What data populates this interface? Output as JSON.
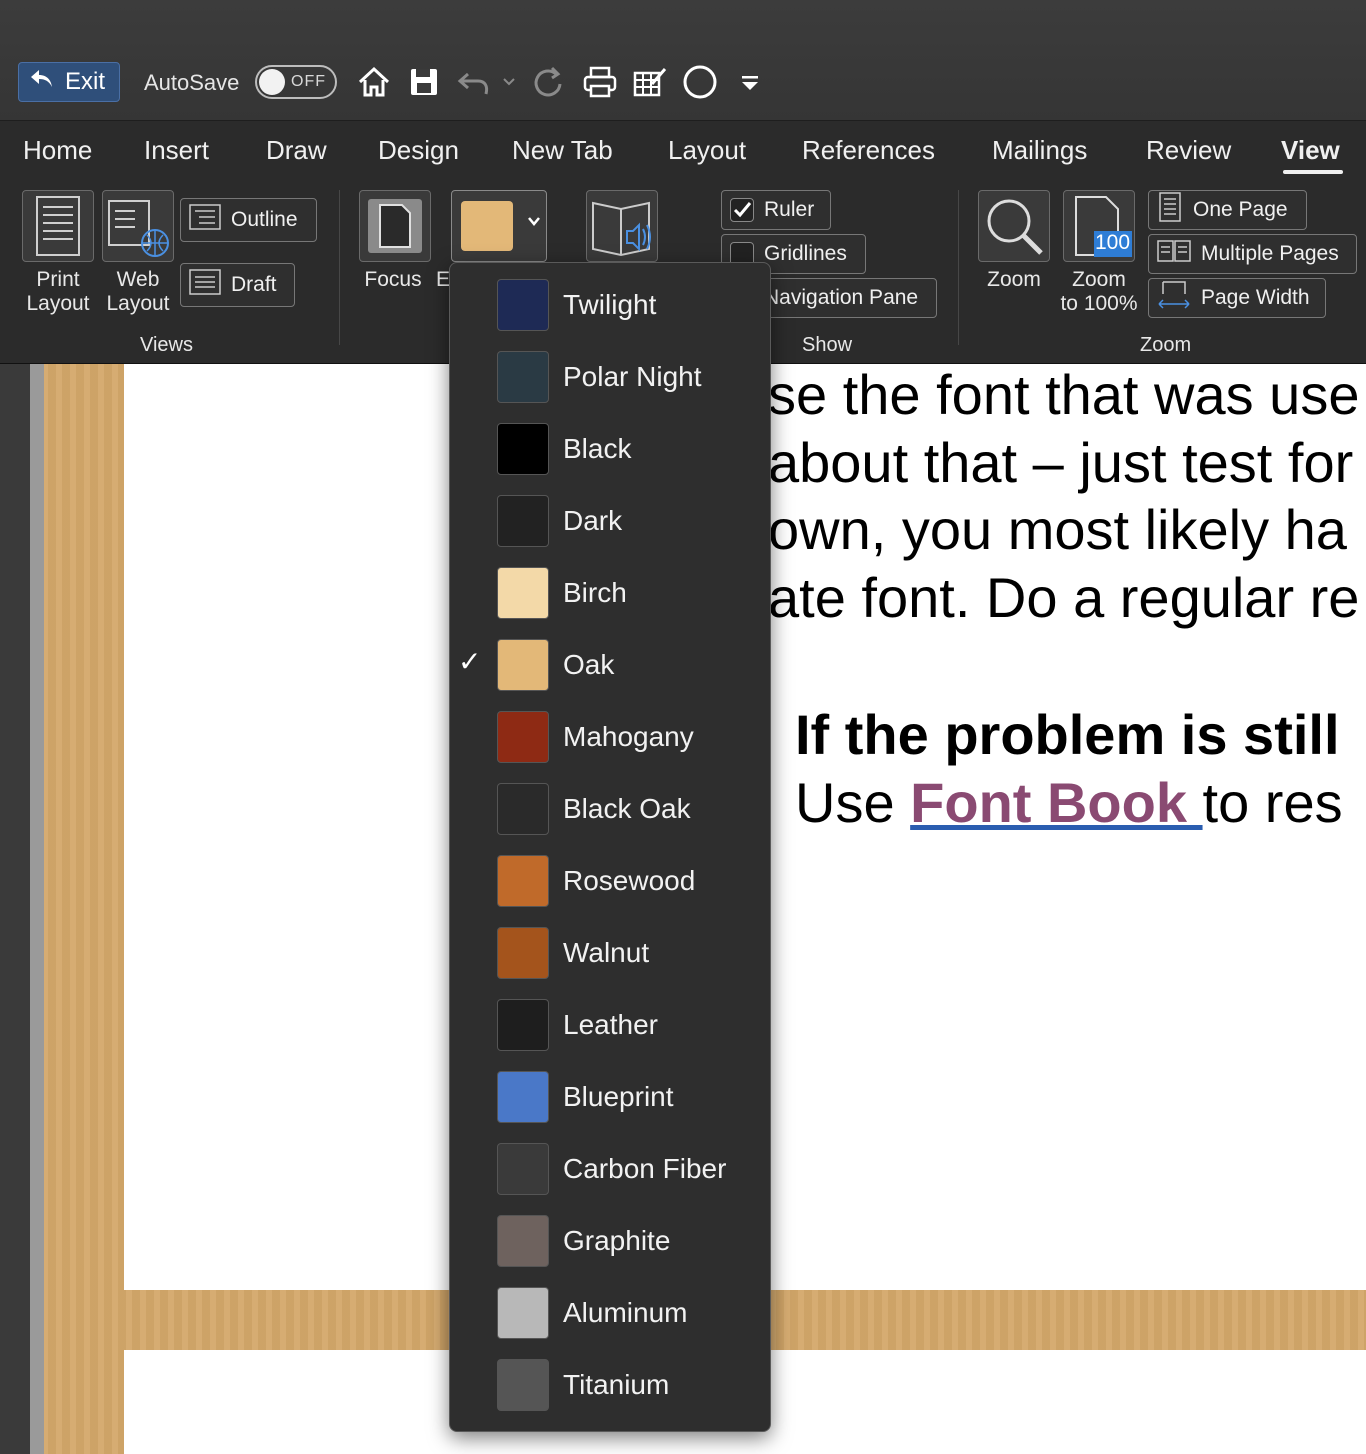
{
  "toolbar": {
    "exit_label": "Exit",
    "autosave_label": "AutoSave",
    "autosave_state": "OFF",
    "icons": [
      "home-icon",
      "save-icon",
      "undo-icon",
      "redo-icon",
      "print-icon",
      "edit-icon",
      "circle-icon",
      "customize-icon"
    ]
  },
  "tabs": [
    "Home",
    "Insert",
    "Draw",
    "Design",
    "New Tab",
    "Layout",
    "References",
    "Mailings",
    "Review",
    "View"
  ],
  "active_tab": "View",
  "ribbon": {
    "views": {
      "group_label": "Views",
      "print_layout": "Print\nLayout",
      "web_layout": "Web\nLayout",
      "outline": "Outline",
      "draft": "Draft"
    },
    "immersive": {
      "focus": "Focus",
      "truncated_label": "E"
    },
    "show": {
      "group_label": "Show",
      "ruler": "Ruler",
      "gridlines": "Gridlines",
      "navigation_pane": "Navigation Pane",
      "ruler_checked": true
    },
    "zoom": {
      "group_label": "Zoom",
      "zoom": "Zoom",
      "zoom_100": "Zoom\nto 100%",
      "zoom_100_badge": "100",
      "one_page": "One Page",
      "multiple_pages": "Multiple Pages",
      "page_width": "Page Width"
    }
  },
  "document": {
    "lines": [
      "se the font that was use",
      "about that – just test for",
      "own, you most likely ha",
      "ate font. Do a regular re"
    ],
    "bold_line": "If the problem is still",
    "link_line_prefix": "Use ",
    "link_text": "Font Book ",
    "link_line_suffix": "to res"
  },
  "background_menu": {
    "selected": "Oak",
    "items": [
      {
        "label": "Twilight",
        "color": "#1e2a55"
      },
      {
        "label": "Polar Night",
        "color": "#2a3a44"
      },
      {
        "label": "Black",
        "color": "#000000"
      },
      {
        "label": "Dark",
        "color": "#222222"
      },
      {
        "label": "Birch",
        "color": "#f3d9a8"
      },
      {
        "label": "Oak",
        "color": "#e3b878"
      },
      {
        "label": "Mahogany",
        "color": "#8e2a14"
      },
      {
        "label": "Black Oak",
        "color": "#2a2a2a"
      },
      {
        "label": "Rosewood",
        "color": "#c06a2a"
      },
      {
        "label": "Walnut",
        "color": "#a4541c"
      },
      {
        "label": "Leather",
        "color": "#1e1e1e"
      },
      {
        "label": "Blueprint",
        "color": "#4a78c8"
      },
      {
        "label": "Carbon Fiber",
        "color": "#3a3a3a"
      },
      {
        "label": "Graphite",
        "color": "#6e625e"
      },
      {
        "label": "Aluminum",
        "color": "#b8b8b8"
      },
      {
        "label": "Titanium",
        "color": "#555555"
      }
    ]
  }
}
